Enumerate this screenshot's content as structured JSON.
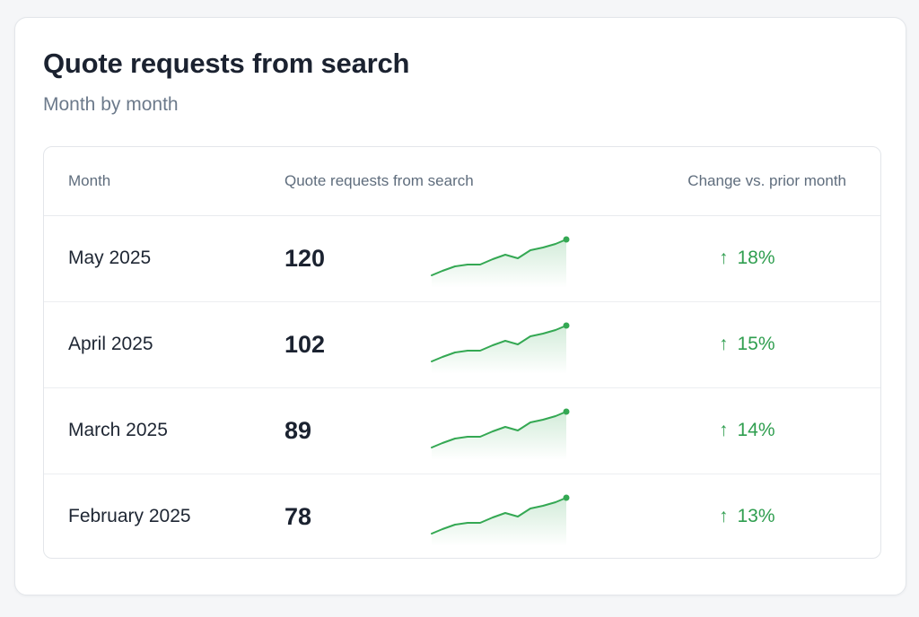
{
  "card": {
    "title": "Quote requests from search",
    "subtitle": "Month by month"
  },
  "table": {
    "headers": {
      "month": "Month",
      "quotes": "Quote requests from search",
      "change": "Change vs. prior month"
    },
    "rows": [
      {
        "month": "May 2025",
        "value": "120",
        "change": "18%",
        "trend": "up"
      },
      {
        "month": "April 2025",
        "value": "102",
        "change": "15%",
        "trend": "up"
      },
      {
        "month": "March 2025",
        "value": "89",
        "change": "14%",
        "trend": "up"
      },
      {
        "month": "February 2025",
        "value": "78",
        "change": "13%",
        "trend": "up"
      }
    ]
  },
  "icons": {
    "trend_up": "arrow-up-icon"
  },
  "colors": {
    "positive": "#2f9e4f",
    "sparkline": "#34a853"
  }
}
